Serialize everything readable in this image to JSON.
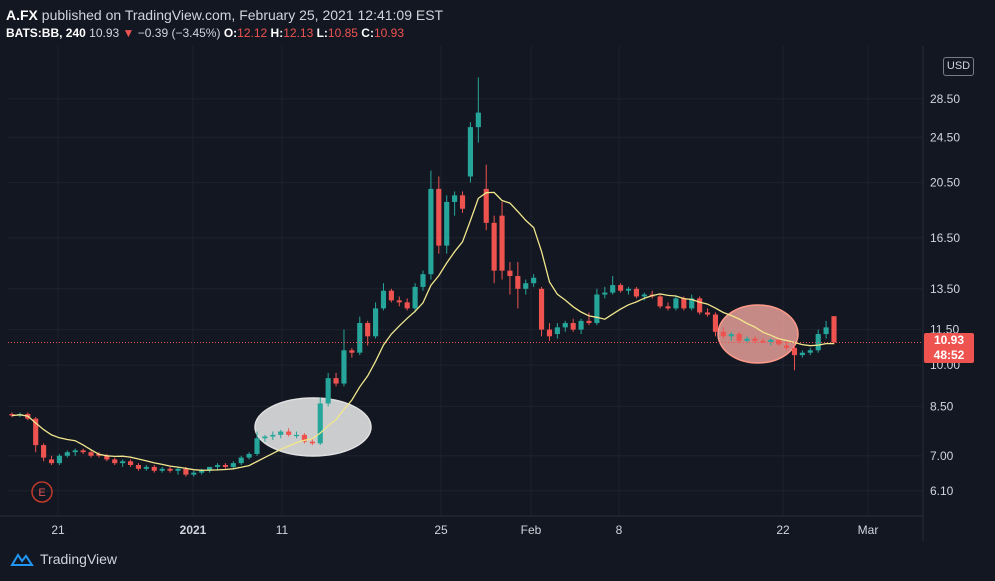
{
  "header": {
    "symbol": "A.FX",
    "published_text": " published on TradingView.com, February 25, 2021 12:41:09 EST",
    "ticker": "BATS:BB, 240",
    "last": "10.93",
    "change": "−0.39 (−3.45%)",
    "open_label": "O:",
    "open": "12.12",
    "high_label": "H:",
    "high": "12.13",
    "low_label": "L:",
    "low": "10.85",
    "close_label": "C:",
    "close": "10.93"
  },
  "price_scale": {
    "currency_label": "USD",
    "last_price_label": "10.93",
    "countdown_label": "48:52"
  },
  "event_marker": {
    "label": "E"
  },
  "footer": {
    "brand": "TradingView"
  },
  "colors": {
    "background": "#131722",
    "up": "#26a69a",
    "down": "#ef5350",
    "ma_line": "#f0e68c",
    "grid": "#1e222d",
    "highlight_ellipse": "#e8e8e8"
  },
  "chart_data": {
    "type": "candlestick",
    "yscale": "log",
    "ylim": [
      5.7,
      34
    ],
    "y_tick_labels": [
      "6.10",
      "7.00",
      "8.50",
      "10.00",
      "11.50",
      "13.50",
      "16.50",
      "20.50",
      "24.50",
      "28.50"
    ],
    "x_tick_labels": [
      "21",
      "2021",
      "11",
      "25",
      "Feb",
      "8",
      "22",
      "Mar"
    ],
    "last_price": 10.93,
    "candles": [
      [
        8.25,
        8.3,
        8.15,
        8.2
      ],
      [
        8.2,
        8.3,
        8.15,
        8.25
      ],
      [
        8.25,
        8.3,
        8.05,
        8.1
      ],
      [
        8.1,
        8.15,
        7.1,
        7.3
      ],
      [
        7.3,
        7.35,
        6.85,
        6.95
      ],
      [
        6.9,
        7.0,
        6.75,
        6.8
      ],
      [
        6.8,
        7.05,
        6.75,
        7.0
      ],
      [
        7.0,
        7.15,
        6.95,
        7.1
      ],
      [
        7.1,
        7.2,
        7.0,
        7.15
      ],
      [
        7.15,
        7.2,
        7.05,
        7.1
      ],
      [
        7.1,
        7.15,
        6.95,
        7.0
      ],
      [
        7.05,
        7.1,
        6.95,
        7.0
      ],
      [
        7.0,
        7.05,
        6.85,
        6.9
      ],
      [
        6.9,
        6.95,
        6.75,
        6.8
      ],
      [
        6.8,
        6.9,
        6.7,
        6.85
      ],
      [
        6.85,
        6.9,
        6.7,
        6.75
      ],
      [
        6.75,
        6.8,
        6.6,
        6.65
      ],
      [
        6.65,
        6.75,
        6.6,
        6.7
      ],
      [
        6.7,
        6.75,
        6.55,
        6.6
      ],
      [
        6.6,
        6.7,
        6.55,
        6.65
      ],
      [
        6.65,
        6.7,
        6.55,
        6.6
      ],
      [
        6.6,
        6.7,
        6.5,
        6.65
      ],
      [
        6.65,
        6.7,
        6.45,
        6.5
      ],
      [
        6.5,
        6.6,
        6.45,
        6.55
      ],
      [
        6.55,
        6.65,
        6.5,
        6.6
      ],
      [
        6.6,
        6.7,
        6.55,
        6.7
      ],
      [
        6.7,
        6.8,
        6.6,
        6.75
      ],
      [
        6.75,
        6.8,
        6.65,
        6.7
      ],
      [
        6.7,
        6.85,
        6.65,
        6.8
      ],
      [
        6.8,
        7.0,
        6.75,
        6.95
      ],
      [
        6.95,
        7.1,
        6.9,
        7.05
      ],
      [
        7.05,
        7.7,
        7.0,
        7.5
      ],
      [
        7.5,
        7.6,
        7.4,
        7.55
      ],
      [
        7.55,
        7.7,
        7.45,
        7.6
      ],
      [
        7.6,
        7.75,
        7.5,
        7.7
      ],
      [
        7.7,
        7.8,
        7.55,
        7.6
      ],
      [
        7.6,
        7.7,
        7.5,
        7.6
      ],
      [
        7.6,
        7.65,
        7.35,
        7.4
      ],
      [
        7.4,
        7.5,
        7.3,
        7.35
      ],
      [
        7.35,
        8.8,
        7.3,
        8.6
      ],
      [
        8.6,
        9.7,
        8.5,
        9.5
      ],
      [
        9.5,
        9.7,
        9.2,
        9.3
      ],
      [
        9.3,
        11.5,
        9.2,
        10.6
      ],
      [
        10.6,
        10.7,
        10.3,
        10.5
      ],
      [
        10.5,
        12.1,
        10.4,
        11.8
      ],
      [
        11.8,
        11.9,
        10.8,
        11.2
      ],
      [
        11.2,
        12.8,
        11.1,
        12.5
      ],
      [
        12.5,
        13.8,
        12.4,
        13.4
      ],
      [
        13.4,
        13.5,
        12.8,
        12.9
      ],
      [
        12.9,
        13.1,
        12.6,
        12.8
      ],
      [
        12.8,
        13.0,
        12.4,
        12.5
      ],
      [
        12.5,
        13.8,
        12.3,
        13.6
      ],
      [
        13.6,
        14.5,
        13.4,
        14.3
      ],
      [
        14.3,
        21.5,
        14.0,
        20.0
      ],
      [
        20.0,
        21.0,
        15.5,
        16.0
      ],
      [
        16.0,
        19.5,
        15.5,
        19.0
      ],
      [
        19.0,
        19.8,
        18.0,
        19.5
      ],
      [
        19.5,
        19.8,
        18.2,
        18.5
      ],
      [
        21.0,
        26.0,
        20.5,
        25.5
      ],
      [
        25.5,
        31.0,
        24.0,
        27.0
      ],
      [
        20.0,
        22.0,
        17.0,
        17.5
      ],
      [
        17.5,
        18.0,
        13.8,
        14.5
      ],
      [
        18.0,
        19.0,
        14.0,
        14.5
      ],
      [
        14.5,
        15.0,
        13.2,
        14.2
      ],
      [
        14.2,
        15.0,
        12.5,
        13.5
      ],
      [
        13.5,
        14.0,
        13.2,
        13.8
      ],
      [
        13.8,
        14.3,
        13.6,
        14.1
      ],
      [
        13.5,
        13.6,
        11.2,
        11.5
      ],
      [
        11.5,
        11.8,
        11.0,
        11.2
      ],
      [
        11.3,
        11.8,
        11.1,
        11.6
      ],
      [
        11.6,
        11.9,
        11.4,
        11.8
      ],
      [
        11.8,
        12.0,
        11.4,
        11.5
      ],
      [
        11.5,
        12.0,
        11.3,
        11.9
      ],
      [
        11.9,
        12.3,
        11.7,
        11.8
      ],
      [
        11.8,
        13.5,
        11.7,
        13.2
      ],
      [
        13.2,
        13.6,
        13.0,
        13.3
      ],
      [
        13.3,
        14.2,
        13.2,
        13.7
      ],
      [
        13.7,
        13.8,
        13.3,
        13.4
      ],
      [
        13.4,
        13.6,
        13.2,
        13.5
      ],
      [
        13.5,
        13.6,
        13.0,
        13.1
      ],
      [
        13.1,
        13.3,
        12.9,
        13.2
      ],
      [
        13.2,
        13.4,
        13.0,
        13.1
      ],
      [
        13.1,
        13.2,
        12.5,
        12.6
      ],
      [
        12.6,
        12.8,
        12.4,
        12.5
      ],
      [
        12.5,
        13.1,
        12.4,
        13.0
      ],
      [
        13.0,
        13.1,
        12.4,
        12.5
      ],
      [
        12.5,
        13.2,
        12.4,
        13.0
      ],
      [
        13.0,
        13.1,
        12.2,
        12.3
      ],
      [
        12.3,
        12.5,
        12.1,
        12.2
      ],
      [
        12.2,
        12.3,
        11.2,
        11.4
      ],
      [
        11.4,
        11.6,
        11.1,
        11.2
      ],
      [
        11.2,
        11.4,
        11.0,
        11.3
      ],
      [
        11.3,
        11.4,
        10.9,
        11.0
      ],
      [
        11.0,
        11.2,
        10.9,
        11.1
      ],
      [
        11.1,
        11.2,
        10.9,
        11.0
      ],
      [
        11.0,
        11.1,
        10.9,
        10.95
      ],
      [
        10.95,
        11.1,
        10.8,
        11.05
      ],
      [
        11.05,
        11.1,
        10.8,
        10.85
      ],
      [
        10.8,
        11.0,
        10.6,
        10.7
      ],
      [
        10.7,
        10.8,
        9.8,
        10.4
      ],
      [
        10.4,
        10.6,
        10.3,
        10.5
      ],
      [
        10.5,
        10.7,
        10.4,
        10.6
      ],
      [
        10.6,
        11.5,
        10.5,
        11.3
      ],
      [
        11.3,
        11.9,
        11.1,
        11.6
      ],
      [
        12.12,
        12.13,
        10.85,
        10.93
      ]
    ]
  }
}
